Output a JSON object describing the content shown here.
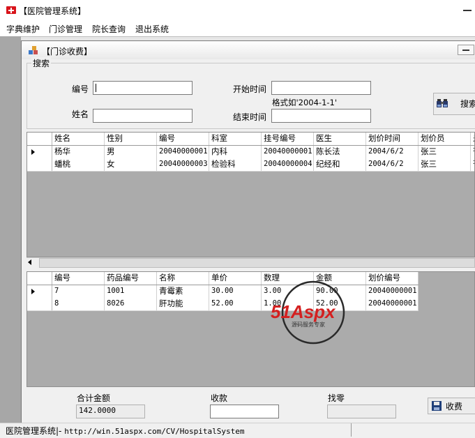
{
  "app": {
    "title": "【医院管理系统】"
  },
  "menu": [
    {
      "label": "字典维护"
    },
    {
      "label": "门诊管理"
    },
    {
      "label": "院长查询"
    },
    {
      "label": "退出系统"
    }
  ],
  "child_window": {
    "title": "【门诊收费】"
  },
  "search": {
    "group_label": "搜索",
    "id_label": "编号",
    "id_value": "",
    "name_label": "姓名",
    "name_value": "",
    "start_label": "开始时间",
    "start_value": "",
    "format_hint": "格式如'2004-1-1'",
    "end_label": "结束时间",
    "end_value": "",
    "button_label": "搜索"
  },
  "patients_grid": {
    "columns": [
      "姓名",
      "性别",
      "编号",
      "科室",
      "挂号编号",
      "医生",
      "划价时间",
      "划价员",
      "是"
    ],
    "rows": [
      [
        "杨华",
        "男",
        "20040000001",
        "内科",
        "20040000001",
        "陈长法",
        "2004/6/2",
        "张三",
        "否"
      ],
      [
        "蟠桃",
        "女",
        "20040000003",
        "检验科",
        "20040000004",
        "纪经和",
        "2004/6/2",
        "张三",
        "否"
      ]
    ],
    "selected_row": 0
  },
  "drugs_grid": {
    "columns": [
      "编号",
      "药品编号",
      "名称",
      "单价",
      "数理",
      "金额",
      "划价编号"
    ],
    "rows": [
      [
        "7",
        "1001",
        "青霉素",
        "30.00",
        "3.00",
        "90.00",
        "20040000001"
      ],
      [
        "8",
        "8026",
        "肝功能",
        "52.00",
        "1.00",
        "52.00",
        "20040000001"
      ]
    ],
    "selected_row": 0
  },
  "watermark": {
    "brand": "51Aspx",
    "tagline": "源码服务专家"
  },
  "totals": {
    "total_label": "合计金额",
    "total_value": "142.0000",
    "received_label": "收款",
    "received_value": "",
    "change_label": "找零",
    "change_value": "",
    "fee_button_label": "收费"
  },
  "statusbar": {
    "text": "医院管理系统|- ",
    "url": "http://win.51aspx.com/CV/HospitalSystem"
  }
}
